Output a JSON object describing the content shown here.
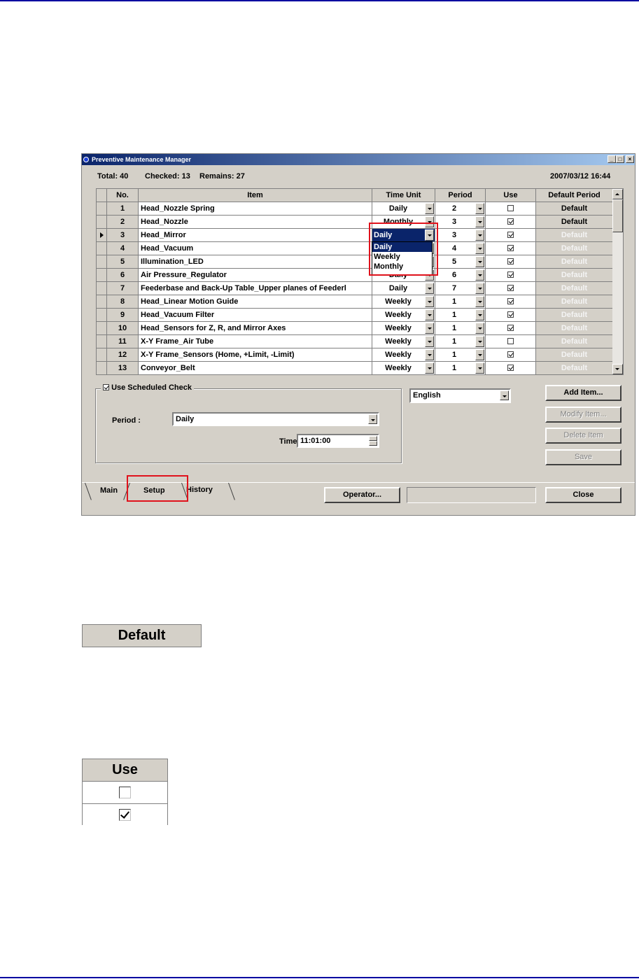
{
  "window": {
    "title": "Preventive Maintenance Manager",
    "controls": {
      "minimize": "_",
      "maximize": "□",
      "close": "×"
    }
  },
  "summary": {
    "total": "Total: 40",
    "checked": "Checked: 13",
    "remains": "Remains: 27",
    "datetime": "2007/03/12 16:44"
  },
  "grid": {
    "columns": [
      "No.",
      "Item",
      "Time Unit",
      "Period",
      "Use",
      "Default Period"
    ],
    "rows": [
      {
        "no": "1",
        "item": "Head_Nozzle Spring",
        "unit": "Daily",
        "period": "2",
        "use": false,
        "default": "Default"
      },
      {
        "no": "2",
        "item": "Head_Nozzle",
        "unit": "Monthly",
        "period": "3",
        "use": true,
        "default": "Default"
      },
      {
        "no": "3",
        "item": "Head_Mirror",
        "unit": "Daily",
        "period": "3",
        "use": true,
        "default": "Default"
      },
      {
        "no": "4",
        "item": "Head_Vacuum",
        "unit": "Daily",
        "period": "4",
        "use": true,
        "default": "Default"
      },
      {
        "no": "5",
        "item": "Illumination_LED",
        "unit": "Daily",
        "period": "5",
        "use": true,
        "default": "Default"
      },
      {
        "no": "6",
        "item": "Air Pressure_Regulator",
        "unit": "Daily",
        "period": "6",
        "use": true,
        "default": "Default"
      },
      {
        "no": "7",
        "item": "Feederbase and Back-Up Table_Upper planes of Feederl",
        "unit": "Daily",
        "period": "7",
        "use": true,
        "default": "Default"
      },
      {
        "no": "8",
        "item": "Head_Linear Motion Guide",
        "unit": "Weekly",
        "period": "1",
        "use": true,
        "default": "Default"
      },
      {
        "no": "9",
        "item": "Head_Vacuum Filter",
        "unit": "Weekly",
        "period": "1",
        "use": true,
        "default": "Default"
      },
      {
        "no": "10",
        "item": "Head_Sensors for Z, R, and Mirror Axes",
        "unit": "Weekly",
        "period": "1",
        "use": true,
        "default": "Default"
      },
      {
        "no": "11",
        "item": "X-Y Frame_Air Tube",
        "unit": "Weekly",
        "period": "1",
        "use": false,
        "default": "Default"
      },
      {
        "no": "12",
        "item": "X-Y Frame_Sensors (Home, +Limit, -Limit)",
        "unit": "Weekly",
        "period": "1",
        "use": true,
        "default": "Default"
      },
      {
        "no": "13",
        "item": "Conveyor_Belt",
        "unit": "Weekly",
        "period": "1",
        "use": true,
        "default": "Default"
      }
    ],
    "time_unit_dropdown": [
      "Daily",
      "Weekly",
      "Monthly"
    ]
  },
  "schedule": {
    "use_scheduled_check": "Use Scheduled Check",
    "period_label": "Period :",
    "period_value": "Daily",
    "time_label": "Time:",
    "time_value": "11:01:00"
  },
  "language": "English",
  "buttons": {
    "add_item": "Add Item...",
    "modify_item": "Modify Item...",
    "delete_item": "Delete Item",
    "save": "Save",
    "operator": "Operator...",
    "close": "Close"
  },
  "tabs": [
    "Main",
    "Setup",
    "History"
  ],
  "illustrations": {
    "default_button": "Default",
    "use_header": "Use"
  },
  "colors": {
    "highlight": "#0a246a",
    "annotation_red": "#e0121c",
    "window_face": "#d4d0c8"
  }
}
